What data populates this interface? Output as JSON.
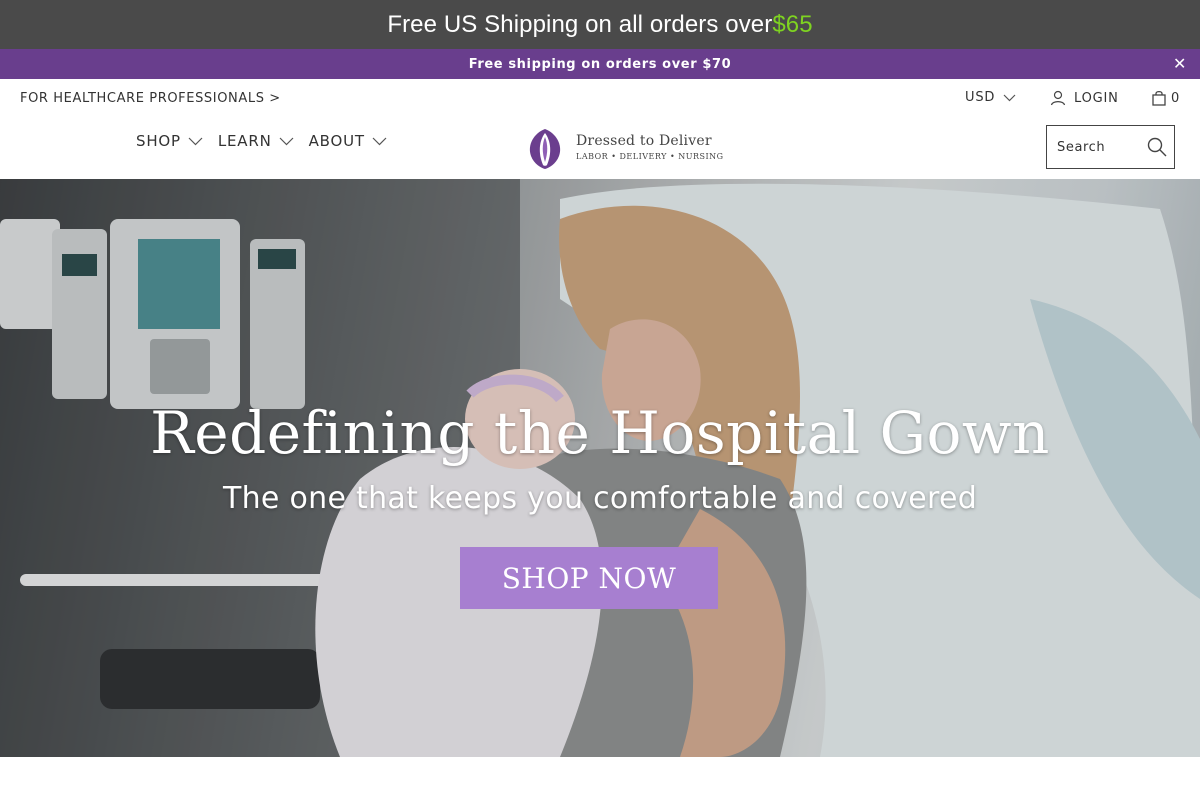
{
  "topbar": {
    "text": "Free US Shipping on all orders over ",
    "amount": "$65"
  },
  "promo": {
    "text": "Free shipping on orders over $70",
    "close_icon": "close-icon"
  },
  "header": {
    "hcp_link": "FOR HEALTHCARE PROFESSIONALS >",
    "currency": "USD",
    "login": "LOGIN",
    "cart_count": "0",
    "nav": [
      {
        "label": "SHOP"
      },
      {
        "label": "LEARN"
      },
      {
        "label": "ABOUT"
      }
    ],
    "logo": {
      "name": "Dressed to Deliver",
      "tagline": "LABOR • DELIVERY • NURSING"
    },
    "search": {
      "placeholder": "Search"
    }
  },
  "hero": {
    "title": "Redefining the Hospital Gown",
    "subtitle": "The one that keeps you comfortable and covered",
    "button": "SHOP NOW"
  },
  "colors": {
    "topbar_bg": "#4a4a4a",
    "amount": "#7ed321",
    "promo_bg": "#693e8d",
    "logo_purple": "#6b3e8e",
    "button_bg": "#a77fd0"
  }
}
